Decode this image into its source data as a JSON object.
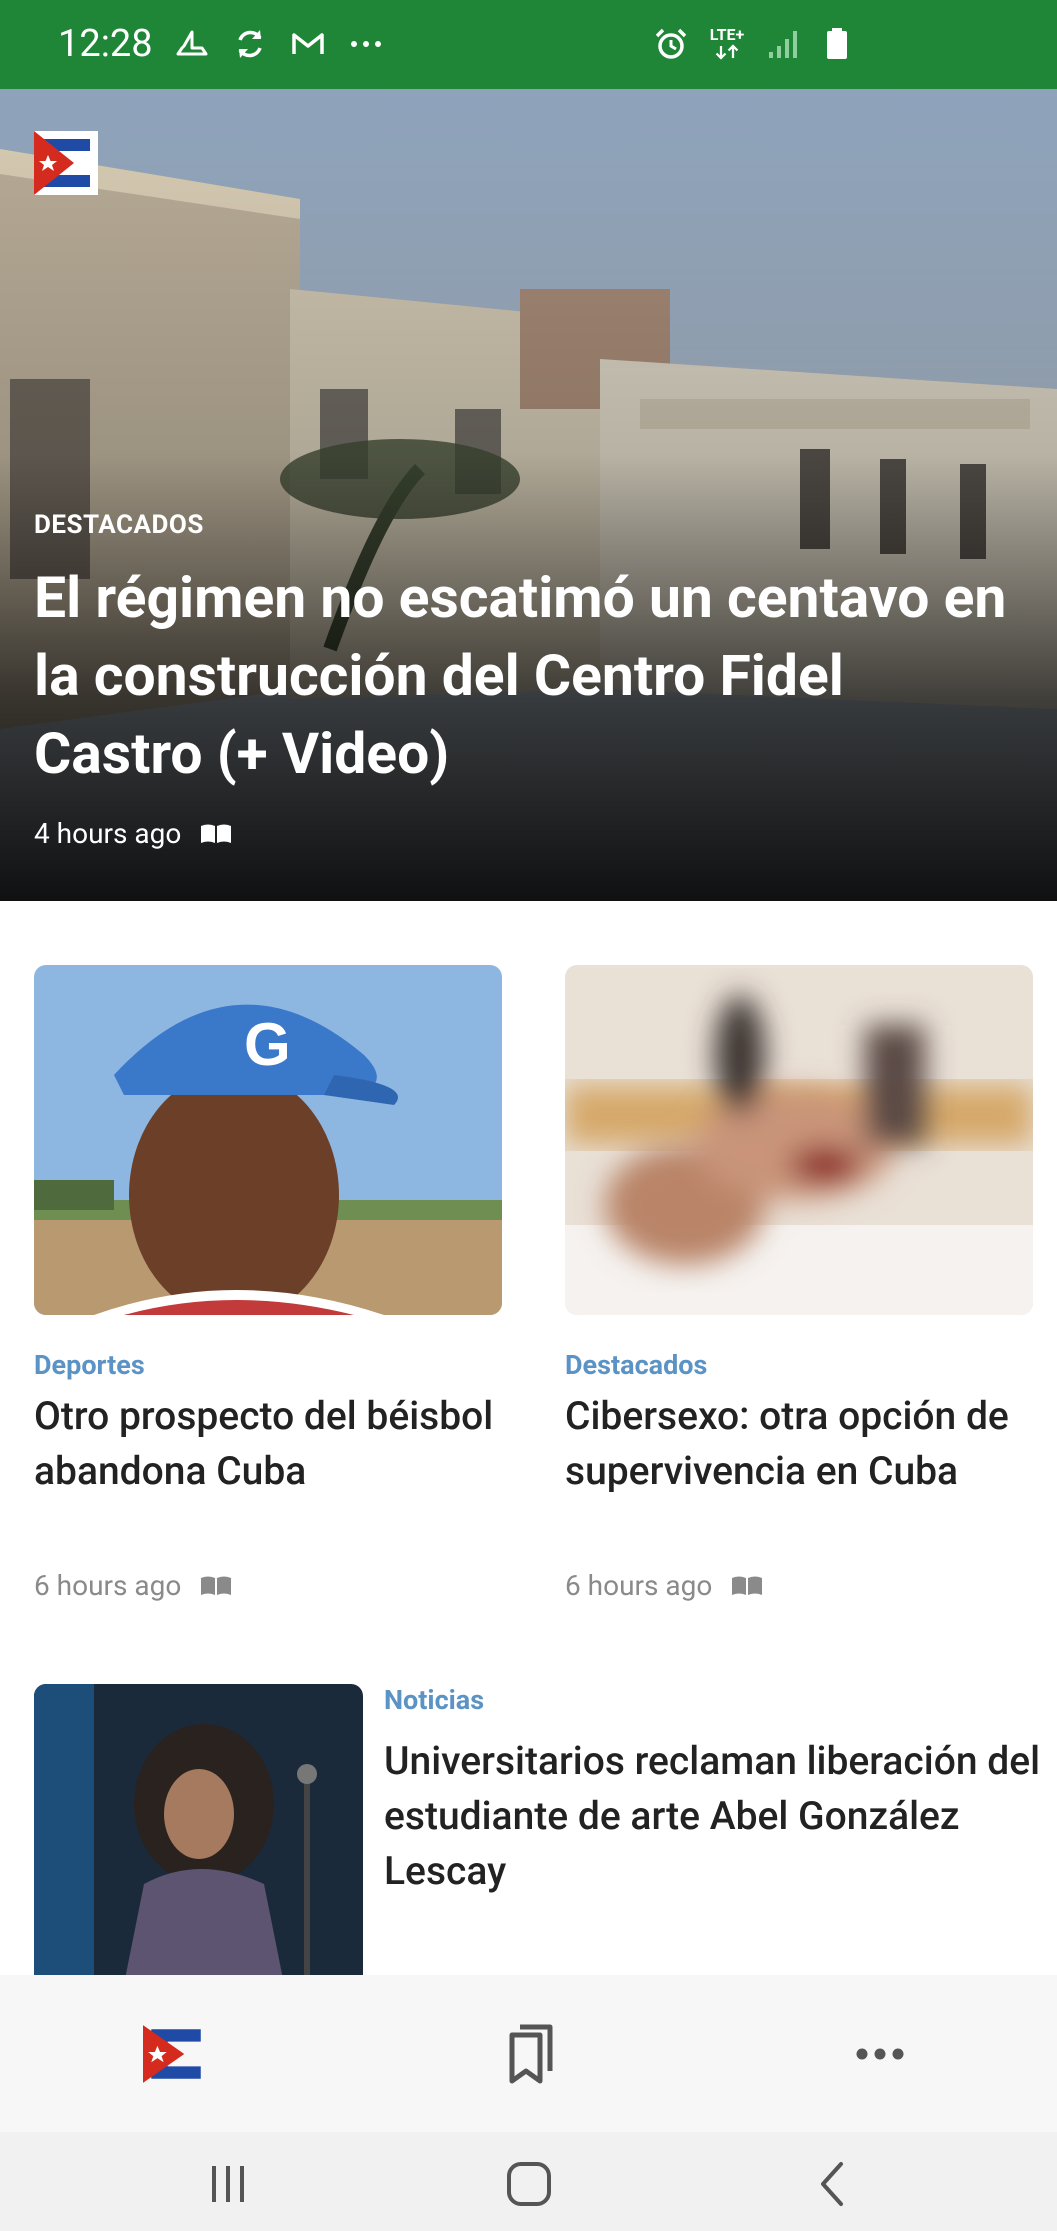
{
  "status_bar": {
    "time": "12:28",
    "network_label": "LTE+",
    "icons": [
      "boat-icon",
      "sync-icon",
      "gmail-icon",
      "more-dots-icon",
      "alarm-icon",
      "lte-icon",
      "signal-icon",
      "battery-icon"
    ]
  },
  "colors": {
    "status_bar_bg": "#1e8636",
    "category_blue": "#5b93c5",
    "flag_blue": "#1f4aa6",
    "flag_red": "#d52b1e"
  },
  "hero": {
    "category": "DESTACADOS",
    "title": "El régimen no escatimó un centavo en la construcción del Centro Fidel Castro (+ Video)",
    "time": "4 hours ago"
  },
  "cards": [
    {
      "category": "Deportes",
      "title": "Otro prospecto del béisbol abandona Cuba",
      "time": "6 hours ago"
    },
    {
      "category": "Destacados",
      "title": "Cibersexo: otra opción de supervivencia en Cuba",
      "time": "6 hours ago"
    }
  ],
  "list_item": {
    "category": "Noticias",
    "title": "Universitarios reclaman liberación del estudiante de arte Abel González Lescay"
  },
  "tab_bar": {
    "tabs": [
      "home-logo-icon",
      "bookmarks-icon",
      "more-horizontal-icon"
    ]
  },
  "nav_bar": {
    "buttons": [
      "recents-icon",
      "home-icon",
      "back-icon"
    ]
  }
}
